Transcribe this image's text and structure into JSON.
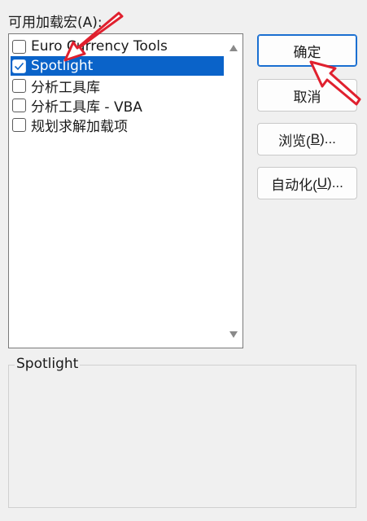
{
  "dialog": {
    "list_label": "可用加载宏",
    "list_label_hotkey": "(A):",
    "addins": [
      {
        "label": "Euro Currency Tools",
        "checked": false,
        "selected": false
      },
      {
        "label": "Spotlight",
        "checked": true,
        "selected": true
      },
      {
        "label": "分析工具库",
        "checked": false,
        "selected": false
      },
      {
        "label": "分析工具库 - VBA",
        "checked": false,
        "selected": false
      },
      {
        "label": "规划求解加载项",
        "checked": false,
        "selected": false
      }
    ],
    "buttons": {
      "ok": "确定",
      "cancel": "取消",
      "browse_pre": "浏览(",
      "browse_key": "B",
      "browse_post": ")...",
      "automation_pre": "自动化(",
      "automation_key": "U",
      "automation_post": ")..."
    },
    "description_title": "Spotlight",
    "description_text": ""
  },
  "colors": {
    "selection": "#0a63c9",
    "annotation_arrow": "#e0202e"
  }
}
